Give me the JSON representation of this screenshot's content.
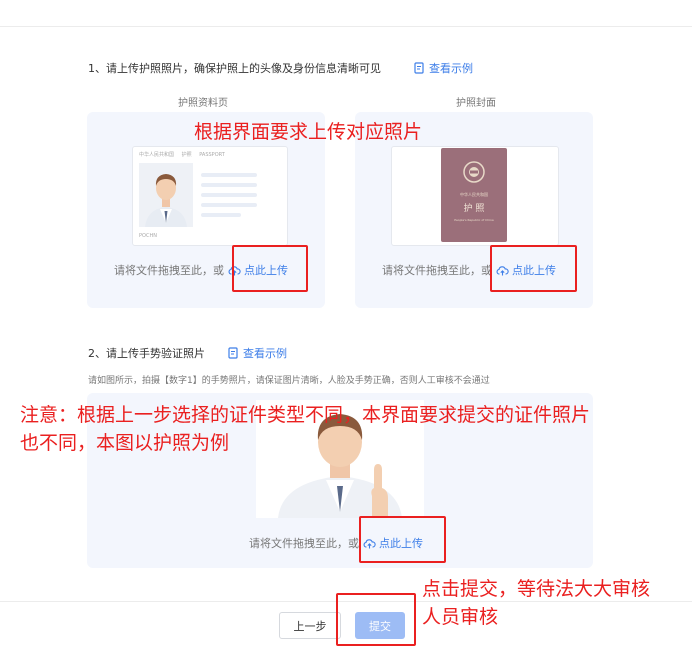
{
  "step1": {
    "title": "1、请上传护照照片，确保护照上的头像及身份信息清晰可见",
    "example_link": "查看示例",
    "left_caption": "护照资料页",
    "right_caption": "护照封面",
    "passport_mini": {
      "header_cn": "中华人民共和国",
      "header_type": "护照",
      "header_en": "PASSPORT",
      "mrz": "POCHN",
      "cover_cn": "中华人民共和国",
      "cover_title": "护  照",
      "cover_en": "People's Republic of China"
    },
    "drop_text": "请将文件拖拽至此，或",
    "upload_label": "点此上传"
  },
  "step2": {
    "title": "2、请上传手势验证照片",
    "example_link": "查看示例",
    "note": "请如图所示，拍摄【数字1】的手势照片，请保证图片清晰，人脸及手势正确，否则人工审核不会通过",
    "drop_text": "请将文件拖拽至此，或",
    "upload_label": "点此上传"
  },
  "annotations": {
    "upload_hint": "根据界面要求上传对应照片",
    "notice_line1": "注意：根据上一步选择的证件类型不同，本界面要求提交的证件照片",
    "notice_line2": "也不同，本图以护照为例",
    "submit_hint_line1": "点击提交，等待法大大审核",
    "submit_hint_line2": "人员审核"
  },
  "footer": {
    "prev_label": "上一步",
    "submit_label": "提交"
  },
  "colors": {
    "accent": "#3d7ee8",
    "annotation_red": "#ea2020",
    "submit_disabled": "#9dbcf5",
    "passport_cover": "#9b6f7a"
  }
}
